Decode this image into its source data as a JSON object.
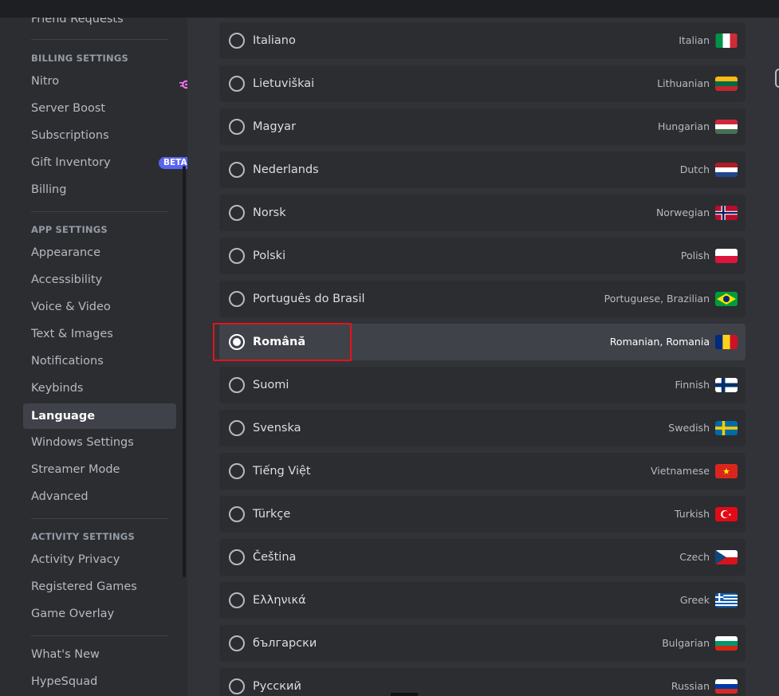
{
  "sidebar": {
    "items_top": [
      {
        "label": "Friend Requests"
      }
    ],
    "billing_header": "BILLING SETTINGS",
    "billing_items": [
      {
        "label": "Nitro",
        "icon": "nitro-icon"
      },
      {
        "label": "Server Boost"
      },
      {
        "label": "Subscriptions"
      },
      {
        "label": "Gift Inventory",
        "badge": "BETA"
      },
      {
        "label": "Billing"
      }
    ],
    "app_header": "APP SETTINGS",
    "app_items": [
      {
        "label": "Appearance"
      },
      {
        "label": "Accessibility"
      },
      {
        "label": "Voice & Video"
      },
      {
        "label": "Text & Images"
      },
      {
        "label": "Notifications"
      },
      {
        "label": "Keybinds"
      },
      {
        "label": "Language",
        "selected": true
      },
      {
        "label": "Windows Settings"
      },
      {
        "label": "Streamer Mode"
      },
      {
        "label": "Advanced"
      }
    ],
    "activity_header": "ACTIVITY SETTINGS",
    "activity_items": [
      {
        "label": "Activity Privacy"
      },
      {
        "label": "Registered Games"
      },
      {
        "label": "Game Overlay"
      }
    ],
    "misc_items": [
      {
        "label": "What's New"
      },
      {
        "label": "HypeSquad"
      }
    ]
  },
  "languages": [
    {
      "native": "Italiano",
      "english": "Italian",
      "flag": "flag-it"
    },
    {
      "native": "Lietuviškai",
      "english": "Lithuanian",
      "flag": "flag-lt"
    },
    {
      "native": "Magyar",
      "english": "Hungarian",
      "flag": "flag-hu"
    },
    {
      "native": "Nederlands",
      "english": "Dutch",
      "flag": "flag-nl"
    },
    {
      "native": "Norsk",
      "english": "Norwegian",
      "flag": "flag-no"
    },
    {
      "native": "Polski",
      "english": "Polish",
      "flag": "flag-pl"
    },
    {
      "native": "Português do Brasil",
      "english": "Portuguese, Brazilian",
      "flag": "flag-br"
    },
    {
      "native": "Română",
      "english": "Romanian, Romania",
      "flag": "flag-ro",
      "selected": true
    },
    {
      "native": "Suomi",
      "english": "Finnish",
      "flag": "flag-fi"
    },
    {
      "native": "Svenska",
      "english": "Swedish",
      "flag": "flag-se"
    },
    {
      "native": "Tiếng Việt",
      "english": "Vietnamese",
      "flag": "flag-vn"
    },
    {
      "native": "Türkçe",
      "english": "Turkish",
      "flag": "flag-tr"
    },
    {
      "native": "Čeština",
      "english": "Czech",
      "flag": "flag-cz"
    },
    {
      "native": "Ελληνικά",
      "english": "Greek",
      "flag": "flag-gr"
    },
    {
      "native": "български",
      "english": "Bulgarian",
      "flag": "flag-bg"
    },
    {
      "native": "Русский",
      "english": "Russian",
      "flag": "flag-ru"
    }
  ],
  "colors": {
    "accent": "#5865f2",
    "highlight_box": "#e3141b",
    "nitro": "#ff73fa"
  }
}
